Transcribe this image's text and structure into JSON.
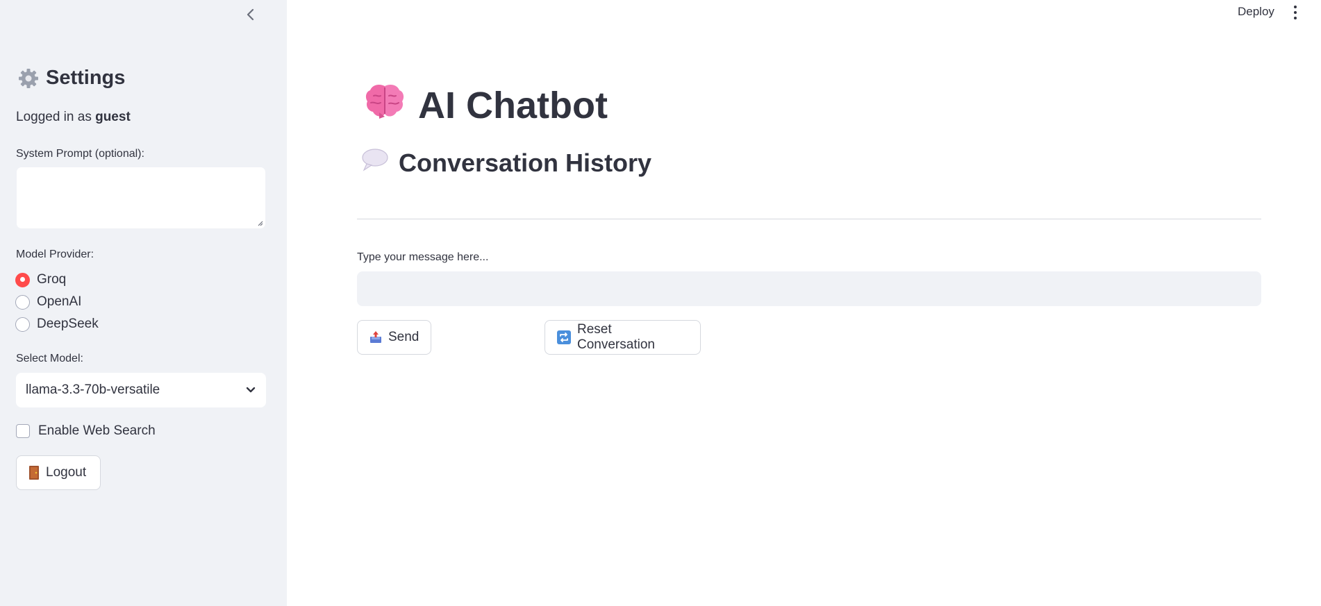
{
  "sidebar": {
    "title": "Settings",
    "title_icon": "gear-icon",
    "logged_in_prefix": "Logged in as ",
    "username": "guest",
    "system_prompt_label": "System Prompt (optional):",
    "system_prompt_value": "",
    "model_provider_label": "Model Provider:",
    "providers": [
      {
        "label": "Groq",
        "checked": true
      },
      {
        "label": "OpenAI",
        "checked": false
      },
      {
        "label": "DeepSeek",
        "checked": false
      }
    ],
    "select_model_label": "Select Model:",
    "selected_model": "llama-3.3-70b-versatile",
    "web_search_label": "Enable Web Search",
    "web_search_checked": false,
    "logout_label": "Logout",
    "logout_icon": "door-icon"
  },
  "header": {
    "deploy_label": "Deploy",
    "menu_icon": "kebab-menu-icon"
  },
  "main": {
    "title": "AI Chatbot",
    "title_icon": "brain-icon",
    "history_title": "Conversation History",
    "history_icon": "speech-bubble-icon",
    "message_label": "Type your message here...",
    "message_value": "",
    "send_label": "Send",
    "send_icon": "outbox-icon",
    "reset_label": "Reset Conversation",
    "reset_icon": "repeat-icon"
  },
  "colors": {
    "accent": "#ff4b4b",
    "sidebar_bg": "#f0f2f6",
    "text": "#31333f"
  }
}
